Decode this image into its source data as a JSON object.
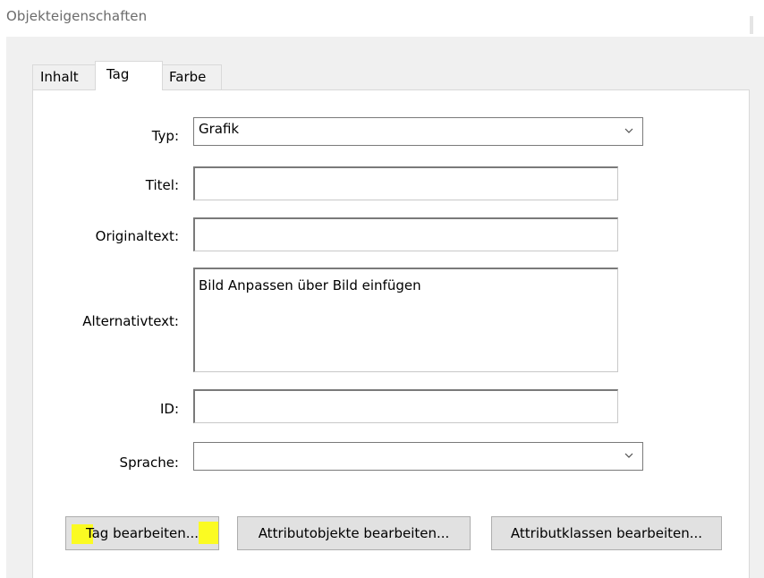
{
  "window": {
    "title": "Objekteigenschaften"
  },
  "tabs": [
    {
      "label": "Inhalt",
      "active": false
    },
    {
      "label": "Tag",
      "active": true
    },
    {
      "label": "Farbe",
      "active": false
    }
  ],
  "form": {
    "type": {
      "label": "Typ:",
      "value": "Grafik",
      "icon": "chevron-down-icon"
    },
    "title": {
      "label": "Titel:",
      "value": ""
    },
    "original_text": {
      "label": "Originaltext:",
      "value": ""
    },
    "alt_text": {
      "label": "Alternativtext:",
      "value": "Bild Anpassen über Bild einfügen"
    },
    "id": {
      "label": "ID:",
      "value": ""
    },
    "language": {
      "label": "Sprache:",
      "value": "",
      "icon": "chevron-down-icon"
    }
  },
  "buttons": {
    "edit_tag": "Tag bearbeiten...",
    "edit_attribute_objects": "Attributobjekte bearbeiten...",
    "edit_attribute_classes": "Attributklassen bearbeiten..."
  },
  "colors": {
    "highlight": "#ffff00",
    "dialog_background": "#f0f0f0",
    "panel_background": "#ffffff"
  }
}
